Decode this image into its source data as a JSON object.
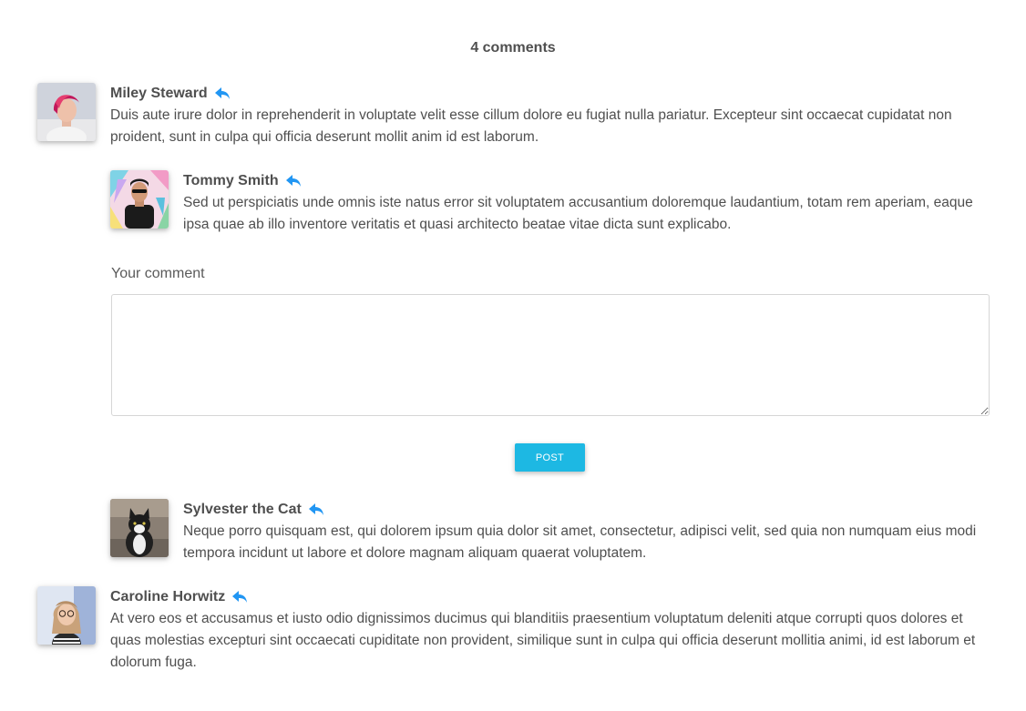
{
  "header": {
    "comments_count_label": "4 comments"
  },
  "colors": {
    "accent": "#1db8e3",
    "reply_icon": "#2196f3",
    "text": "#4f4f4f"
  },
  "comments": [
    {
      "author": "Miley Steward",
      "text": "Duis aute irure dolor in reprehenderit in voluptate velit esse cillum dolore eu fugiat nulla pariatur. Excepteur sint occaecat cupidatat non proident, sunt in culpa qui officia deserunt mollit anim id est laborum.",
      "icon": "reply-icon"
    },
    {
      "author": "Tommy Smith",
      "text": "Sed ut perspiciatis unde omnis iste natus error sit voluptatem accusantium doloremque laudantium, totam rem aperiam, eaque ipsa quae ab illo inventore veritatis et quasi architecto beatae vitae dicta sunt explicabo.",
      "icon": "reply-icon"
    },
    {
      "author": "Sylvester the Cat",
      "text": "Neque porro quisquam est, qui dolorem ipsum quia dolor sit amet, consectetur, adipisci velit, sed quia non numquam eius modi tempora incidunt ut labore et dolore magnam aliquam quaerat voluptatem.",
      "icon": "reply-icon"
    },
    {
      "author": "Caroline Horwitz",
      "text": "At vero eos et accusamus et iusto odio dignissimos ducimus qui blanditiis praesentium voluptatum deleniti atque corrupti quos dolores et quas molestias excepturi sint occaecati cupiditate non provident, similique sunt in culpa qui officia deserunt mollitia animi, id est laborum et dolorum fuga.",
      "icon": "reply-icon"
    }
  ],
  "form": {
    "label": "Your comment",
    "value": "",
    "post_label": "POST"
  }
}
